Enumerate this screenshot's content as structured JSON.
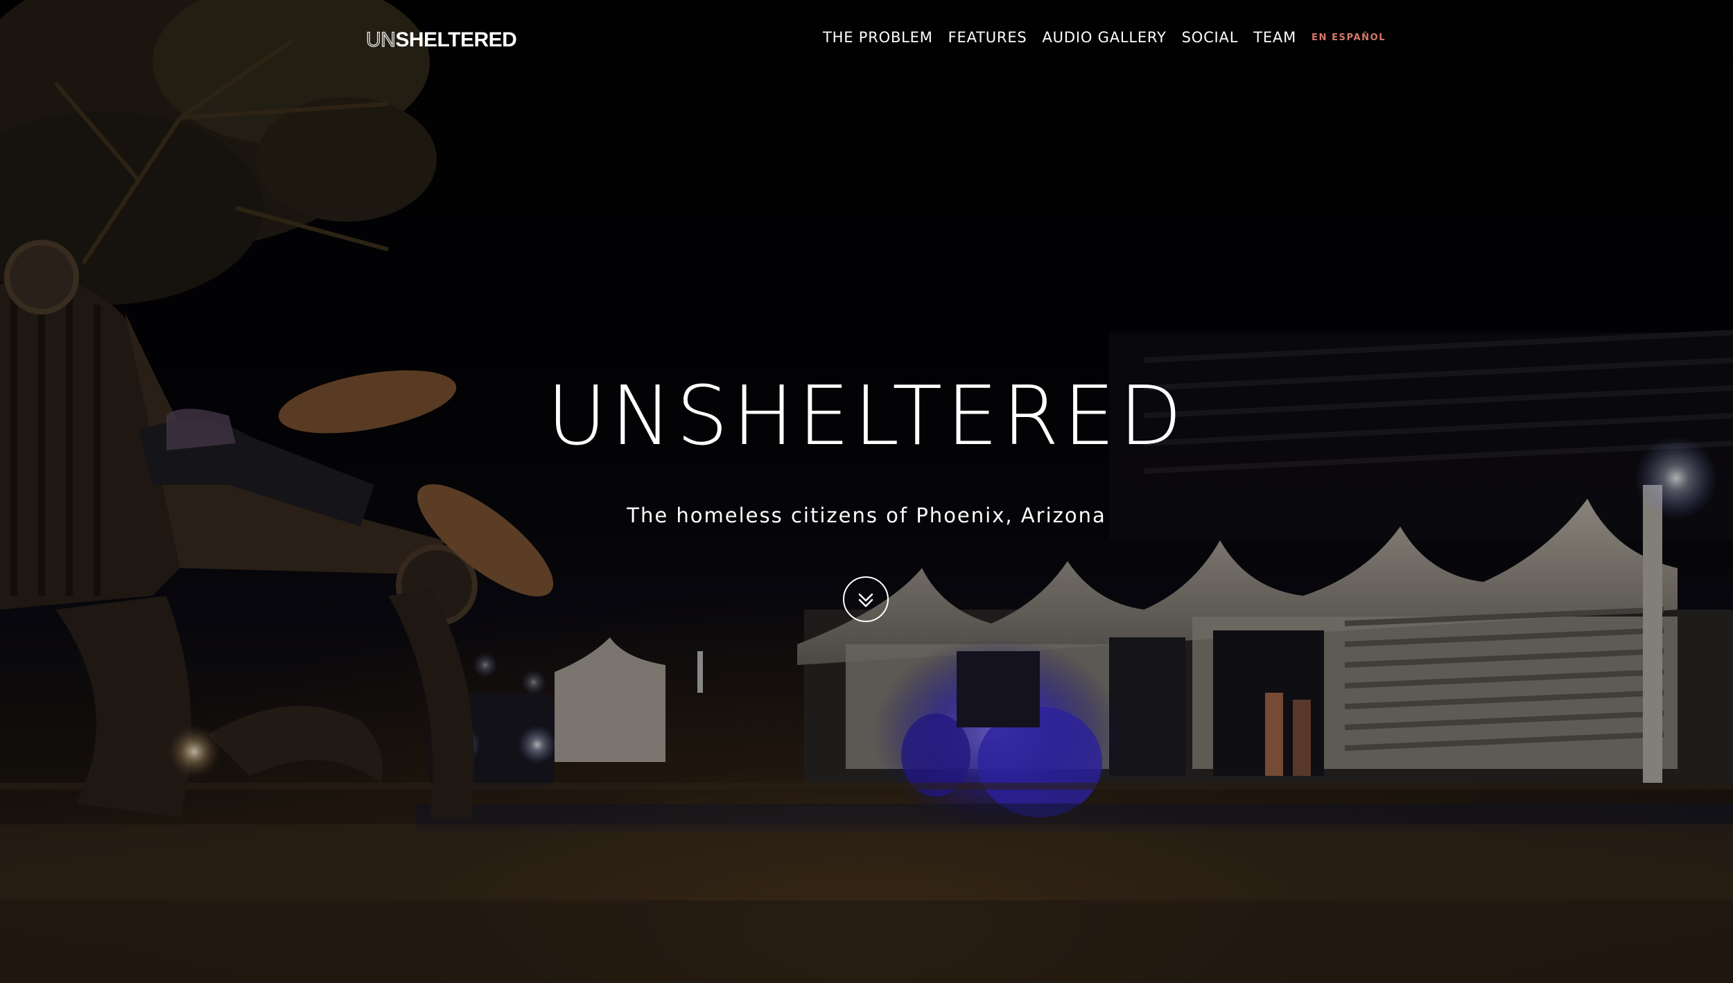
{
  "logo": {
    "part_thin": "UN",
    "part_bold": "SHELTERED"
  },
  "nav": {
    "items": [
      "THE PROBLEM",
      "FEATURES",
      "AUDIO GALLERY",
      "SOCIAL",
      "TEAM"
    ],
    "language_link": "EN ESPAÑOL",
    "language_color": "#d8786a"
  },
  "hero": {
    "title": "UNSHELTERED",
    "subtitle": "The homeless citizens of Phoenix, Arizona",
    "scroll_icon": "double-chevron-down-icon",
    "background": "night street scene: park bench with sleeping person, bus shelters, motorcycle with blue lights"
  }
}
